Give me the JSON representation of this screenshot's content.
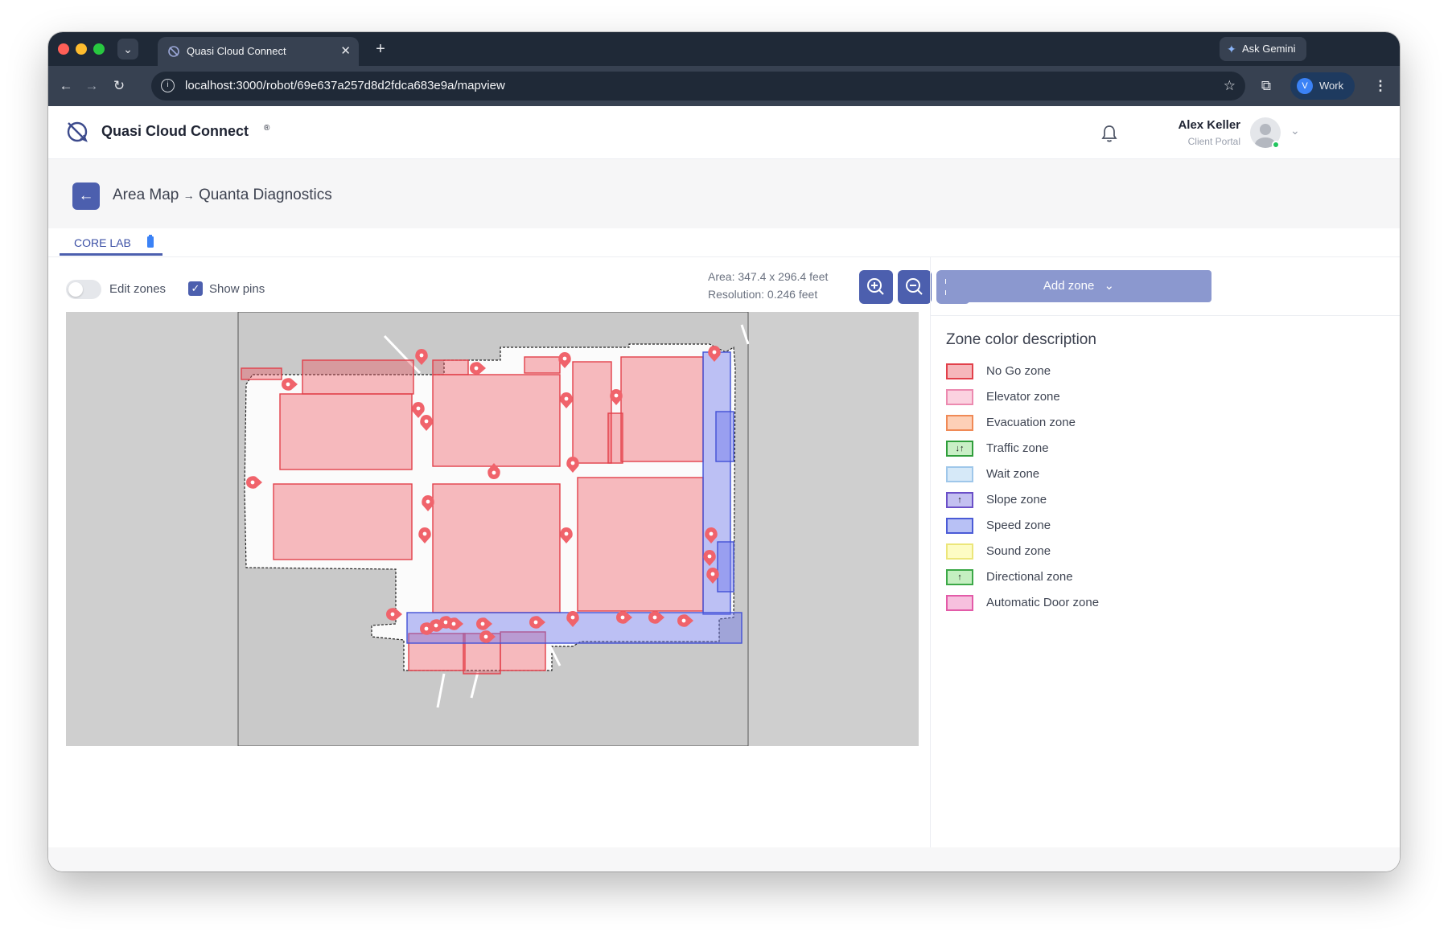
{
  "browser": {
    "tab_title": "Quasi Cloud Connect",
    "url": "localhost:3000/robot/69e637a257d8d2fdca683e9a/mapview",
    "ask_gemini": "Ask Gemini",
    "profile_initial": "V",
    "profile_label": "Work"
  },
  "app": {
    "brand": "Quasi Cloud Connect",
    "brand_mark": "®",
    "user_name": "Alex Keller",
    "user_role": "Client Portal"
  },
  "breadcrumb": {
    "root": "Area Map",
    "separator": "→",
    "current": "Quanta Diagnostics"
  },
  "tabs": [
    {
      "label": "CORE LAB",
      "active": true
    }
  ],
  "controls": {
    "edit_zones_label": "Edit zones",
    "edit_zones_on": false,
    "show_pins_label": "Show pins",
    "show_pins_checked": true,
    "area": "Area: 347.4 x 296.4 feet",
    "resolution": "Resolution: 0.246 feet"
  },
  "sidebar": {
    "add_zone_label": "Add zone",
    "legend_title": "Zone color description",
    "legend": [
      {
        "label": "No Go zone",
        "fill": "#f6b7bb",
        "stroke": "#e2404a",
        "icon": ""
      },
      {
        "label": "Elevator zone",
        "fill": "#fbd2e0",
        "stroke": "#ec8ab0",
        "icon": ""
      },
      {
        "label": "Evacuation zone",
        "fill": "#fdd0b7",
        "stroke": "#f08a56",
        "icon": ""
      },
      {
        "label": "Traffic zone",
        "fill": "#c9efc6",
        "stroke": "#2f9e3b",
        "icon": "↓↑"
      },
      {
        "label": "Wait zone",
        "fill": "#d6e9f8",
        "stroke": "#9fc7ea",
        "icon": ""
      },
      {
        "label": "Slope zone",
        "fill": "#c3c0f1",
        "stroke": "#6b50c8",
        "icon": "↑"
      },
      {
        "label": "Speed zone",
        "fill": "#b8c1f5",
        "stroke": "#4b5bd6",
        "icon": ""
      },
      {
        "label": "Sound zone",
        "fill": "#fdfcc4",
        "stroke": "#ece67a",
        "icon": ""
      },
      {
        "label": "Directional zone",
        "fill": "#c5efc1",
        "stroke": "#3ca847",
        "icon": "↑"
      },
      {
        "label": "Automatic Door zone",
        "fill": "#f7c0de",
        "stroke": "#e35ba8",
        "icon": ""
      }
    ]
  },
  "colors": {
    "accent": "#4c5fae",
    "nogo_fill": "rgba(240,80,90,0.38)",
    "nogo_stroke": "#e2404a",
    "speed_fill": "rgba(110,120,235,0.45)",
    "speed_stroke": "#4150d6",
    "pin": "#f0636b"
  }
}
